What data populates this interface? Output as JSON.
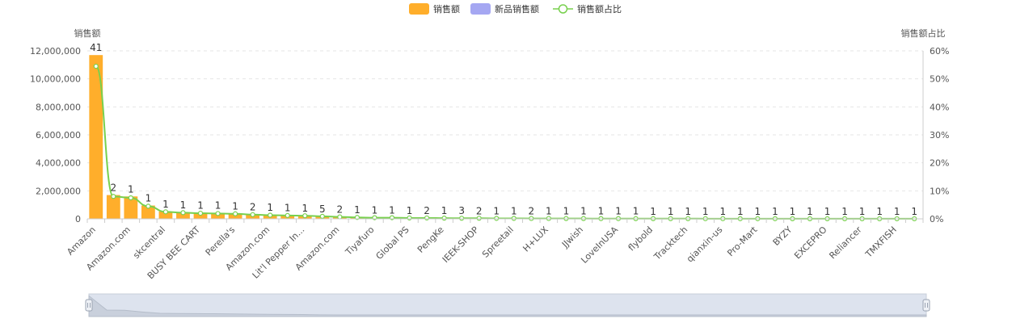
{
  "chart_data": {
    "type": "bar",
    "legend": {
      "position": "top-center",
      "items": [
        {
          "label": "销售额",
          "kind": "bar",
          "color": "#ffae2b"
        },
        {
          "label": "新品销售额",
          "kind": "bar",
          "color": "#a5a7f2"
        },
        {
          "label": "销售额占比",
          "kind": "line",
          "color": "#78d04e"
        }
      ]
    },
    "y_left": {
      "label": "销售额",
      "ticks": [
        "0",
        "2,000,000",
        "4,000,000",
        "6,000,000",
        "8,000,000",
        "10,000,000",
        "12,000,000"
      ],
      "ylim": [
        0,
        12000000
      ]
    },
    "y_right": {
      "label": "销售额占比",
      "ticks": [
        "0%",
        "10%",
        "20%",
        "30%",
        "40%",
        "50%",
        "60%"
      ],
      "ylim": [
        0,
        60
      ]
    },
    "grid": true,
    "categories": [
      "Amazon",
      "",
      "Amazon.com",
      "",
      "skcentral",
      "",
      "BUSY BEE CART",
      "",
      "Perella's",
      "",
      "Amazon.com",
      "",
      "Lit'l Pepper In...",
      "",
      "Amazon.com",
      "",
      "Tiyafuro",
      "",
      "Global PS",
      "",
      "PengKe",
      "",
      "IEEK-SHOP",
      "",
      "Spreetail",
      "",
      "H+LUX",
      "",
      "JJwish",
      "",
      "LoveInUSA",
      "",
      "flybold",
      "",
      "Tracktech",
      "",
      "qianxin-us",
      "",
      "Pro-Mart",
      "",
      "BYZY",
      "",
      "EXCEPRO",
      "",
      "Reliancer",
      "",
      "TMXFISH",
      ""
    ],
    "series": [
      {
        "name": "销售额",
        "type": "bar",
        "color": "#ffae2b",
        "values": [
          11700000,
          1700000,
          1600000,
          950000,
          520000,
          470000,
          440000,
          420000,
          380000,
          330000,
          290000,
          260000,
          240000,
          180000,
          150000,
          110000,
          90000,
          80000,
          70000,
          60000,
          50000,
          45000,
          40000,
          35000,
          30000,
          27000,
          25000,
          22000,
          20000,
          18000,
          16000,
          15000,
          14000,
          13000,
          12000,
          11000,
          10000,
          9000,
          8500,
          8000,
          7500,
          7000,
          6500,
          6000,
          5500,
          5000,
          4500,
          4000
        ],
        "labels": [
          "41",
          "2",
          "1",
          "1",
          "1",
          "1",
          "1",
          "1",
          "1",
          "2",
          "1",
          "1",
          "1",
          "5",
          "2",
          "1",
          "1",
          "1",
          "1",
          "2",
          "1",
          "3",
          "2",
          "1",
          "1",
          "2",
          "1",
          "1",
          "1",
          "1",
          "1",
          "1",
          "1",
          "1",
          "1",
          "1",
          "1",
          "1",
          "1",
          "1",
          "1",
          "1",
          "1",
          "1",
          "1",
          "1",
          "1",
          "1"
        ]
      },
      {
        "name": "新品销售额",
        "type": "bar",
        "color": "#a5a7f2",
        "values": []
      },
      {
        "name": "销售额占比",
        "type": "line",
        "color": "#78d04e",
        "axis": "right",
        "values": [
          54.5,
          8,
          7.5,
          4.5,
          2.5,
          2.2,
          2,
          1.9,
          1.8,
          1.5,
          1.3,
          1.2,
          1.1,
          0.9,
          0.7,
          0.5,
          0.4,
          0.4,
          0.3,
          0.3,
          0.25,
          0.2,
          0.2,
          0.15,
          0.15,
          0.12,
          0.12,
          0.1,
          0.1,
          0.08,
          0.08,
          0.07,
          0.07,
          0.06,
          0.06,
          0.05,
          0.05,
          0.04,
          0.04,
          0.04,
          0.03,
          0.03,
          0.03,
          0.03,
          0.02,
          0.02,
          0.02,
          0.02
        ]
      }
    ]
  }
}
